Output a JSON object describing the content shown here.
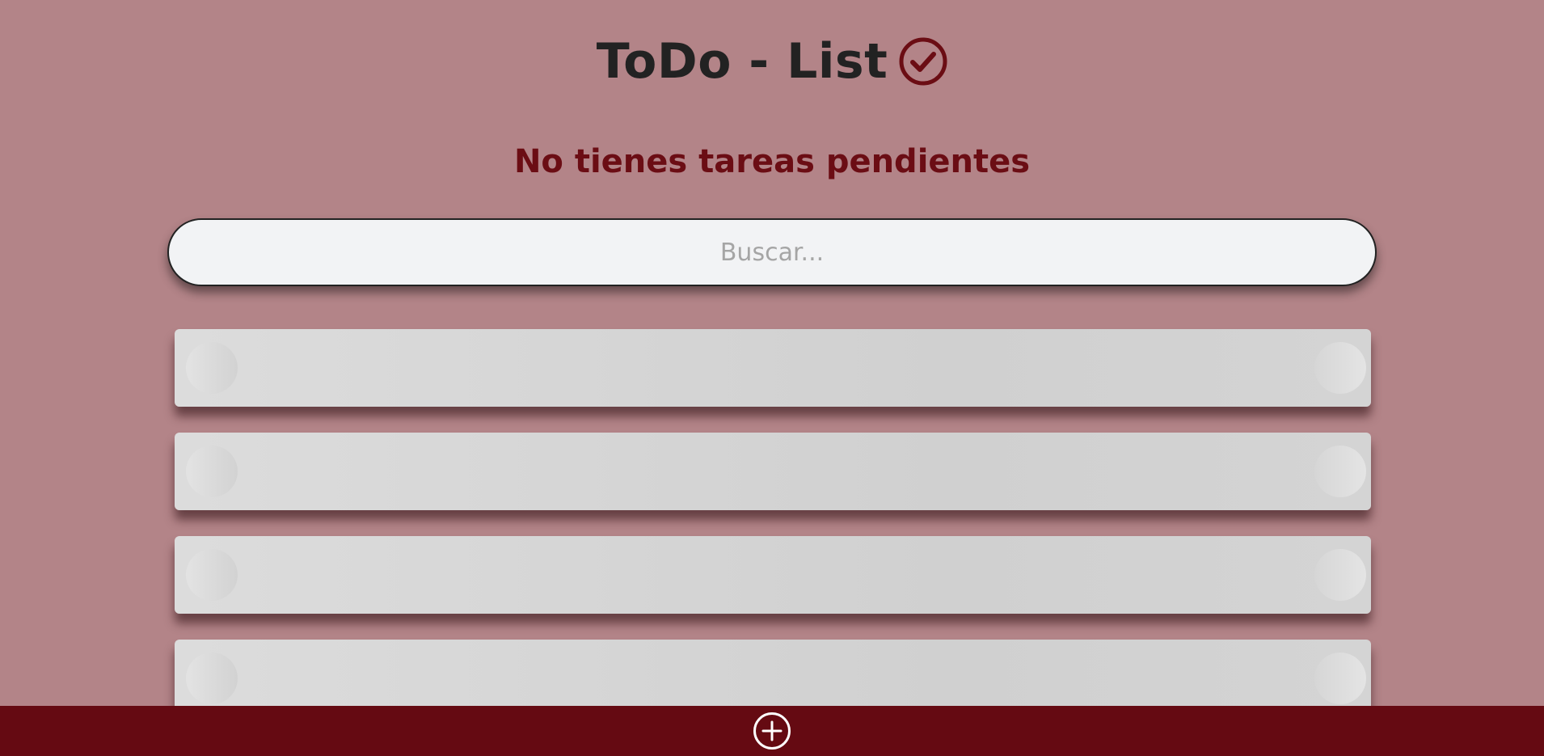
{
  "header": {
    "title": "ToDo - List",
    "title_icon": "check-circle-icon"
  },
  "status": {
    "message": "No tienes tareas pendientes"
  },
  "search": {
    "placeholder": "Buscar...",
    "value": ""
  },
  "todo_list": {
    "items": [
      {
        "left_icon": "loading-placeholder-circle",
        "right_icon": "loading-placeholder-circle"
      },
      {
        "left_icon": "loading-placeholder-circle",
        "right_icon": "loading-placeholder-circle"
      },
      {
        "left_icon": "loading-placeholder-circle",
        "right_icon": "loading-placeholder-circle"
      },
      {
        "left_icon": "loading-placeholder-circle",
        "right_icon": "loading-placeholder-circle"
      }
    ]
  },
  "footer": {
    "add_button_icon": "plus-circle-icon"
  },
  "colors": {
    "background": "#b38488",
    "accent": "#650a12",
    "status_text": "#6b0d14",
    "title_text": "#222222",
    "search_background": "#f2f3f5",
    "item_skeleton": "#d6d6d6"
  }
}
